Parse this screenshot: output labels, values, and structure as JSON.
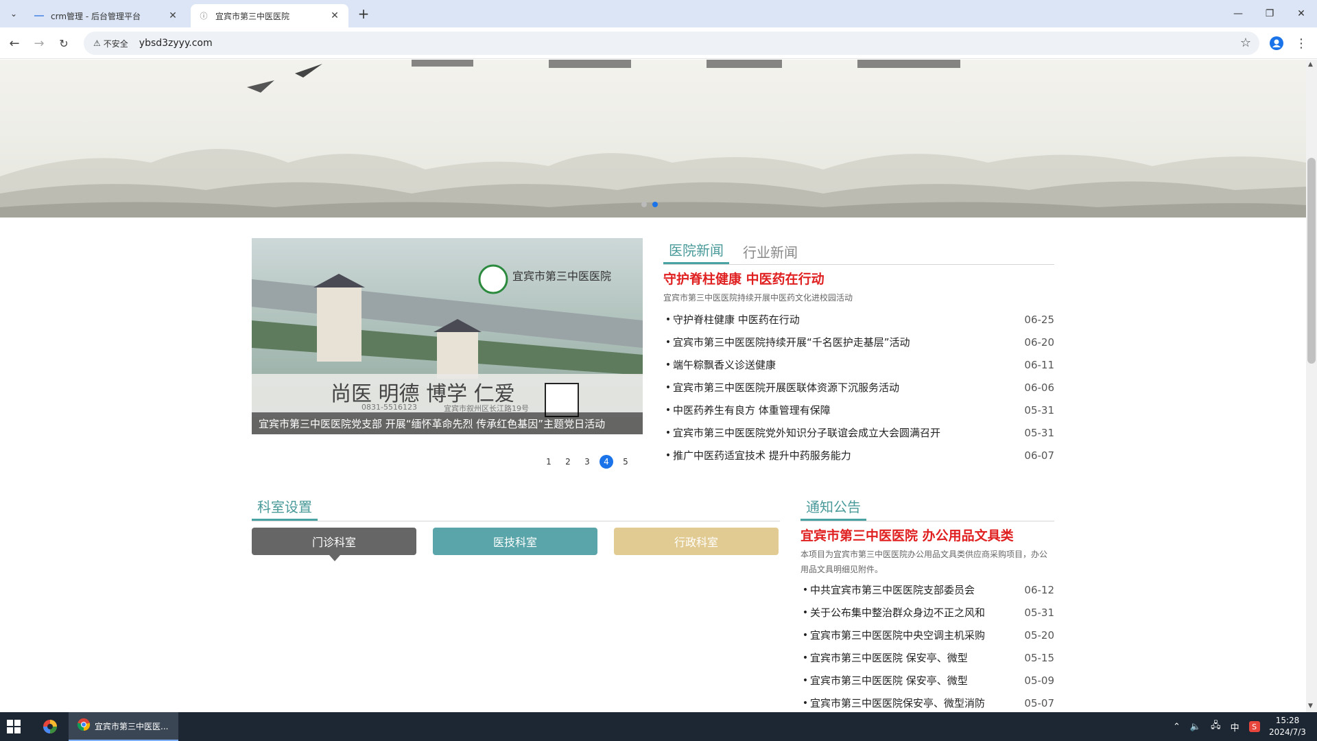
{
  "browser": {
    "tabs": [
      {
        "title": "crm管理 - 后台管理平台",
        "icon": "crm-favicon"
      },
      {
        "title": "宜宾市第三中医医院",
        "icon": "page-info-favicon"
      }
    ],
    "new_tab_label": "+",
    "insecure_label": "不安全",
    "url": "ybsd3zyyy.com"
  },
  "carousel": {
    "caption": "宜宾市第三中医医院党支部 开展“缅怀革命先烈 传承红色基因”主题党日活动",
    "image_hospital_name": "宜宾市第三中医医院",
    "image_slogan": "尚医 明德 博学 仁爱",
    "image_phone": "0831-5516123",
    "image_address": "宜宾市叙州区长江路19号",
    "pages": [
      "1",
      "2",
      "3",
      "4",
      "5"
    ],
    "active_page": 4
  },
  "news": {
    "tabs": [
      "医院新闻",
      "行业新闻"
    ],
    "headline": "守护脊柱健康 中医药在行动",
    "summary": "宜宾市第三中医医院持续开展中医药文化进校园活动",
    "items": [
      {
        "title": "守护脊柱健康 中医药在行动",
        "date": "06-25"
      },
      {
        "title": "宜宾市第三中医医院持续开展“千名医护走基层”活动",
        "date": "06-20"
      },
      {
        "title": "端午粽飘香义诊送健康",
        "date": "06-11"
      },
      {
        "title": "宜宾市第三中医医院开展医联体资源下沉服务活动",
        "date": "06-06"
      },
      {
        "title": "中医药养生有良方 体重管理有保障",
        "date": "05-31"
      },
      {
        "title": "宜宾市第三中医医院党外知识分子联谊会成立大会圆满召开",
        "date": "05-31"
      },
      {
        "title": "推广中医药适宜技术 提升中药服务能力",
        "date": "06-07"
      }
    ]
  },
  "departments": {
    "heading": "科室设置",
    "buttons": [
      {
        "label": "门诊科室",
        "color": "#666666"
      },
      {
        "label": "医技科室",
        "color": "#5aa5aa"
      },
      {
        "label": "行政科室",
        "color": "#e2cb92"
      }
    ]
  },
  "notices": {
    "heading": "通知公告",
    "headline": "宜宾市第三中医医院 办公用品文具类",
    "summary": "本项目为宜宾市第三中医医院办公用品文具类供应商采购项目，办公用品文具明细见附件。",
    "items": [
      {
        "title": "中共宜宾市第三中医医院支部委员会",
        "date": "06-12"
      },
      {
        "title": "关于公布集中整治群众身边不正之风和",
        "date": "05-31"
      },
      {
        "title": "宜宾市第三中医医院中央空调主机采购",
        "date": "05-20"
      },
      {
        "title": "宜宾市第三中医医院 保安亭、微型",
        "date": "05-15"
      },
      {
        "title": "宜宾市第三中医医院 保安亭、微型",
        "date": "05-09"
      },
      {
        "title": "宜宾市第三中医医院保安亭、微型消防",
        "date": "05-07"
      }
    ]
  },
  "taskbar": {
    "app_label": "宜宾市第三中医医...",
    "ime": "中",
    "time": "15:28",
    "date": "2024/7/3"
  },
  "colors": {
    "accent_teal": "#4aa3a3",
    "headline_red": "#e02020",
    "active_page_blue": "#1a73e8"
  }
}
